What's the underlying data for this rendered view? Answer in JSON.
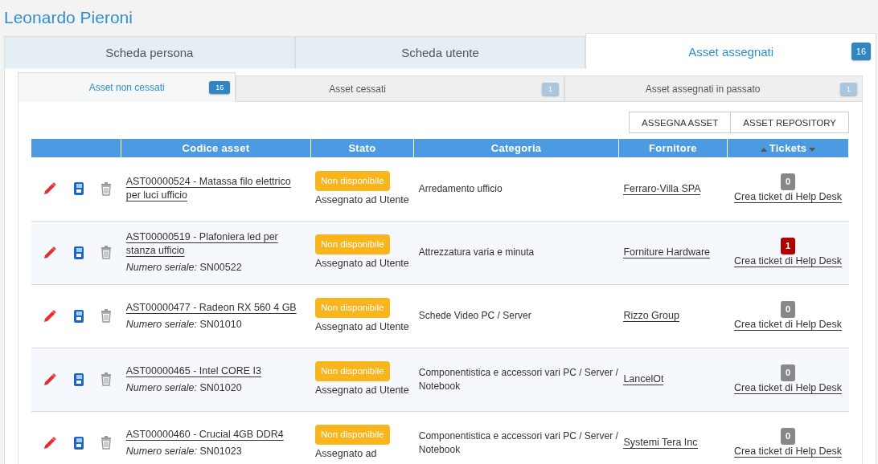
{
  "title": "Leonardo Pieroni",
  "tabs": [
    {
      "label": "Scheda persona",
      "selected": false
    },
    {
      "label": "Scheda utente",
      "selected": false
    },
    {
      "label": "Asset assegnati",
      "selected": true,
      "badge": "16"
    }
  ],
  "subtabs": [
    {
      "label": "Asset non cessati",
      "selected": true,
      "badge": "16"
    },
    {
      "label": "Asset cessati",
      "selected": false,
      "badge": "1"
    },
    {
      "label": "Asset assegnati in passato",
      "selected": false,
      "badge": "1"
    }
  ],
  "buttons": [
    "ASSEGNA ASSET",
    "ASSET REPOSITORY"
  ],
  "table": {
    "columns": [
      "Codice asset",
      "Stato",
      "Categoria",
      "Fornitore",
      "Tickets"
    ],
    "rows": [
      {
        "asset": "AST00000524 - Matassa filo elettrico per luci ufficio",
        "serial_label": "",
        "serial": "",
        "status": "Non disponibile",
        "status_note": "Assegnato ad Utente",
        "category": "Arredamento ufficio",
        "supplier": "Ferraro-Villa SPA",
        "tickets": "0",
        "color": "#888888",
        "ticket_link": "Crea ticket di Help Desk"
      },
      {
        "asset": "AST00000519 - Plafoniera led per stanza ufficio",
        "serial_label": "Numero seriale:",
        "serial": "SN00522",
        "status": "Non disponibile",
        "status_note": "Assegnato ad Utente",
        "category": "Attrezzatura varia e minuta",
        "supplier": "Forniture Hardware",
        "tickets": "1",
        "color": "#b00000",
        "ticket_link": "Crea ticket di Help Desk"
      },
      {
        "asset": "AST00000477 - Radeon RX 560 4 GB",
        "serial_label": "Numero seriale:",
        "serial": "SN01010",
        "status": "Non disponibile",
        "status_note": "Assegnato ad Utente",
        "category": "Schede Video PC / Server",
        "supplier": "Rizzo Group",
        "tickets": "0",
        "color": "#888888",
        "ticket_link": "Crea ticket di Help Desk"
      },
      {
        "asset": "AST00000465 - Intel CORE I3",
        "serial_label": "Numero seriale:",
        "serial": "SN01020",
        "status": "Non disponibile",
        "status_note": "Assegnato ad Utente",
        "category": "Componentistica e accessori vari PC / Server / Notebook",
        "supplier": "LancelOt",
        "tickets": "0",
        "color": "#888888",
        "ticket_link": "Crea ticket di Help Desk"
      },
      {
        "asset": "AST00000460 - Crucial 4GB DDR4",
        "serial_label": "Numero seriale:",
        "serial": "SN01023",
        "status": "Non disponibile",
        "status_note": "Assegnato ad",
        "category": "Componentistica e accessori vari PC / Server / Notebook",
        "supplier": "Systemi Tera Inc",
        "tickets": "0",
        "color": "#888888",
        "ticket_link": "Crea ticket di Help Desk"
      }
    ]
  }
}
